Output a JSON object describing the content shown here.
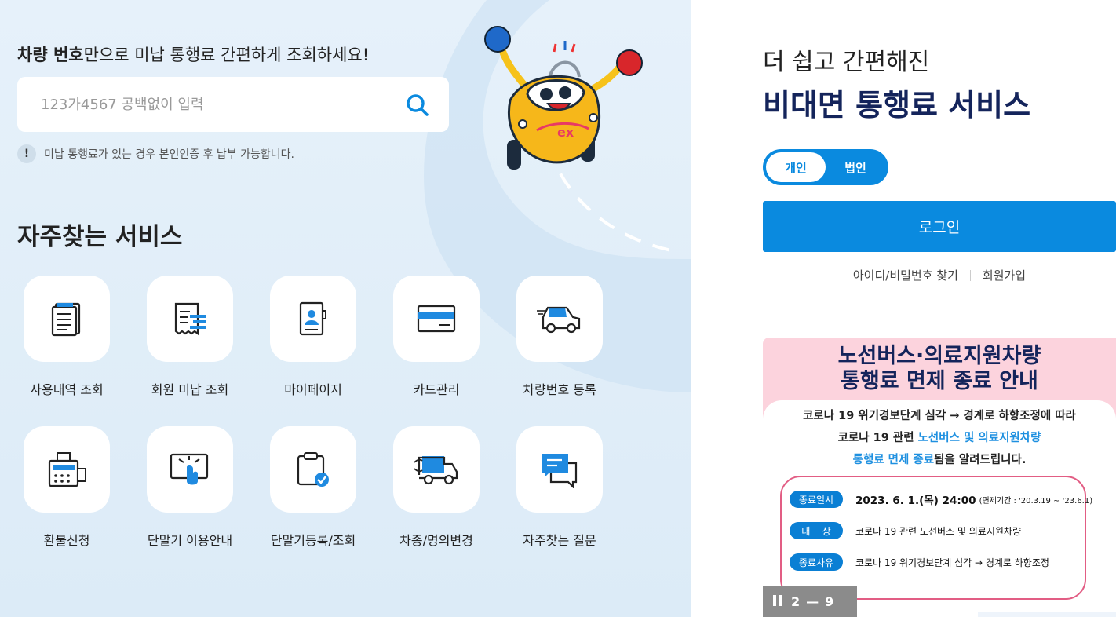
{
  "search": {
    "title_bold": "차량 번호",
    "title_rest": "만으로 미납 통행료 간편하게 조회하세요!",
    "placeholder": "123가4567 공백없이 입력",
    "notice_mark": "!",
    "notice": "미납 통행료가 있는 경우 본인인증 후 납부 가능합니다."
  },
  "services": {
    "title": "자주찾는 서비스",
    "items": [
      {
        "label": "사용내역 조회",
        "icon": "document-list-icon"
      },
      {
        "label": "회원 미납 조회",
        "icon": "receipt-icon"
      },
      {
        "label": "마이페이지",
        "icon": "profile-card-icon"
      },
      {
        "label": "카드관리",
        "icon": "credit-card-icon"
      },
      {
        "label": "차량번호 등록",
        "icon": "car-icon"
      },
      {
        "label": "환불신청",
        "icon": "refund-machine-icon"
      },
      {
        "label": "단말기 이용안내",
        "icon": "touch-screen-icon"
      },
      {
        "label": "단말기등록/조회",
        "icon": "clipboard-check-icon"
      },
      {
        "label": "차종/명의변경",
        "icon": "truck-change-icon"
      },
      {
        "label": "자주찾는 질문",
        "icon": "chat-bubble-icon"
      }
    ]
  },
  "mascot": {
    "logo_text": "ex"
  },
  "right": {
    "subtitle": "더 쉽고 간편해진",
    "title": "비대면 통행료 서비스",
    "toggle": {
      "personal": "개인",
      "corporate": "법인",
      "selected": "개인"
    },
    "login_label": "로그인",
    "find_label": "아이디/비밀번호 찾기",
    "join_label": "회원가입"
  },
  "banner": {
    "title_line1": "노선버스·의료지원차량",
    "title_line2": "통행료 면제 종료 안내",
    "line1": "코로나 19 위기경보단계 심각 → 경계로 하향조정에 따라",
    "line2_a": "코로나 19 관련 ",
    "line2_hl": "노선버스 및 의료지원차량",
    "line3_hl": "통행료 면제 종료",
    "line3_b": "됨을 알려드립니다.",
    "rows": [
      {
        "tag": "종료일시",
        "value": "2023. 6. 1.(목) 24:00",
        "note": "(면제기간 : '20.3.19 ~ '23.6.1)"
      },
      {
        "tag": "대    상",
        "value": "코로나 19 관련  노선버스 및 의료지원차량"
      },
      {
        "tag": "종료사유",
        "value": "코로나 19 위기경보단계  심각 → 경계로 하향조정"
      }
    ]
  },
  "slider": {
    "current": "2",
    "separator": "—",
    "total": "9"
  },
  "colors": {
    "primary": "#0a8adf",
    "navy": "#14245b",
    "banner_pink": "#fcd3dd",
    "border_pink": "#e25d84"
  }
}
